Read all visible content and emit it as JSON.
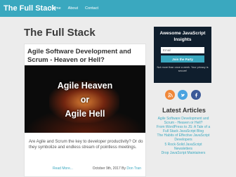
{
  "nav": {
    "brand": "The Full Stack",
    "links": [
      "Home",
      "About",
      "Contact"
    ]
  },
  "page": {
    "title": "The Full Stack"
  },
  "post": {
    "title": "Agile Software Development and Scrum - Heaven or Hell?",
    "image_lines": [
      "Agile Heaven",
      "or",
      "Agile Hell"
    ],
    "excerpt": "Are Agile and Scrum the key to developer productivity? Or do they symbolize and endless stream of pointless meetings.",
    "read_more": "Read More...",
    "date": "October 9th, 2017 By",
    "author": "Don Tran"
  },
  "newsletter": {
    "title": "Awesome JavaScript Insights",
    "placeholder": "Email",
    "button": "Join the Party",
    "note": "Not more than once a week. Your privacy is secure!"
  },
  "social": {
    "icons": [
      "rss-icon",
      "twitter-icon",
      "facebook-icon"
    ],
    "colors": {
      "rss": "#f0883a",
      "twitter": "#4aa3e0",
      "facebook": "#3b5998"
    }
  },
  "latest": {
    "title": "Latest Articles",
    "items": [
      "Agile Software Development and",
      "Scrum - Heaven or Hell?",
      "From WordPress to JS: A Tale of a",
      "Full Stack JavaScript Blog",
      "The Habits of Effective JavaScript",
      "Developers",
      "5 Rock-Solid JavaScript",
      "Newsletters",
      "Drop JavaScript Maintainers"
    ]
  },
  "colors": {
    "accent": "#3aa8bf",
    "navbar": "#3aa8bf",
    "sidebar_dark": "#0f1e2d",
    "page_bg": "#ececec"
  }
}
